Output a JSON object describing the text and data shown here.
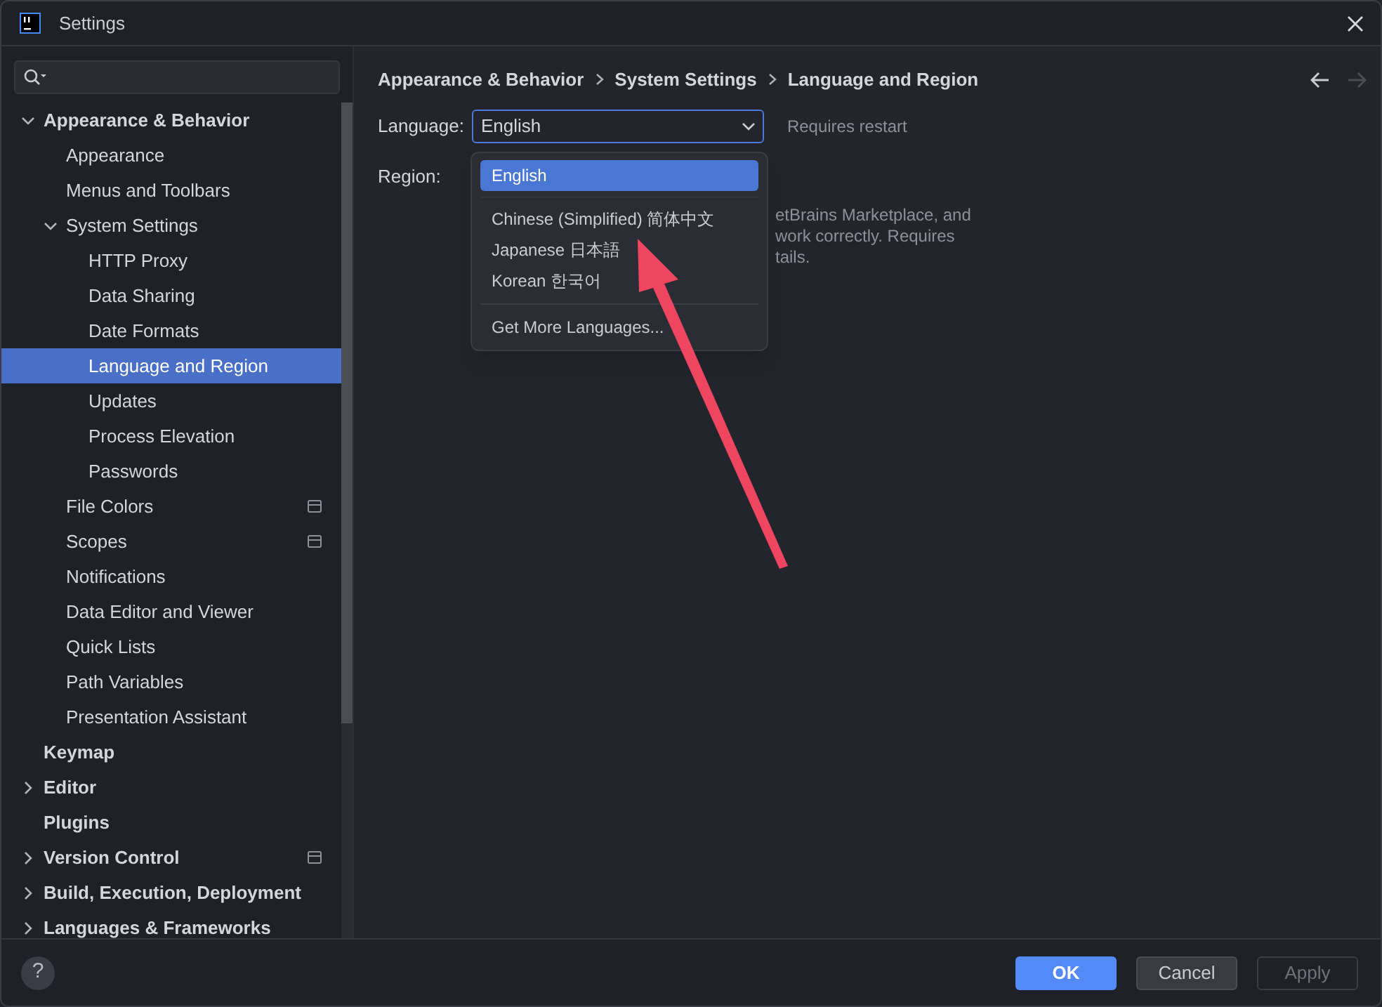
{
  "window": {
    "title": "Settings"
  },
  "sidebar": {
    "items": [
      {
        "label": "Appearance & Behavior",
        "expanded": true,
        "selected": false,
        "children": [
          {
            "label": "Appearance",
            "selected": false
          },
          {
            "label": "Menus and Toolbars",
            "selected": false
          },
          {
            "label": "System Settings",
            "expanded": true,
            "selected": false,
            "children": [
              {
                "label": "HTTP Proxy",
                "selected": false
              },
              {
                "label": "Data Sharing",
                "selected": false
              },
              {
                "label": "Date Formats",
                "selected": false
              },
              {
                "label": "Language and Region",
                "selected": true
              },
              {
                "label": "Updates",
                "selected": false
              },
              {
                "label": "Process Elevation",
                "selected": false
              },
              {
                "label": "Passwords",
                "selected": false
              }
            ]
          },
          {
            "label": "File Colors",
            "selected": false,
            "project_level": true
          },
          {
            "label": "Scopes",
            "selected": false,
            "project_level": true
          },
          {
            "label": "Notifications",
            "selected": false
          },
          {
            "label": "Data Editor and Viewer",
            "selected": false
          },
          {
            "label": "Quick Lists",
            "selected": false
          },
          {
            "label": "Path Variables",
            "selected": false
          },
          {
            "label": "Presentation Assistant",
            "selected": false
          }
        ]
      },
      {
        "label": "Keymap",
        "selected": false
      },
      {
        "label": "Editor",
        "expanded": false,
        "selected": false
      },
      {
        "label": "Plugins",
        "selected": false
      },
      {
        "label": "Version Control",
        "expanded": false,
        "selected": false,
        "project_level": true
      },
      {
        "label": "Build, Execution, Deployment",
        "expanded": false,
        "selected": false
      },
      {
        "label": "Languages & Frameworks",
        "expanded": false,
        "selected": false
      }
    ]
  },
  "breadcrumbs": [
    "Appearance & Behavior",
    "System Settings",
    "Language and Region"
  ],
  "navigation": {
    "back_enabled": true,
    "forward_enabled": false
  },
  "form": {
    "language": {
      "label": "Language:",
      "value": "English",
      "note": "Requires restart"
    },
    "region": {
      "label": "Region:",
      "hint_lines": [
        "etBrains Marketplace, and",
        "work correctly. Requires",
        "tails."
      ]
    }
  },
  "dropdown": {
    "options": [
      {
        "label": "English",
        "selected": true
      },
      {
        "label": "Chinese (Simplified) 简体中文",
        "selected": false
      },
      {
        "label": "Japanese 日本語",
        "selected": false
      },
      {
        "label": "Korean 한국어",
        "selected": false
      }
    ],
    "more": "Get More Languages..."
  },
  "buttons": [
    {
      "label": "OK",
      "kind": "primary",
      "disabled": false
    },
    {
      "label": "Cancel",
      "kind": "secondary",
      "disabled": false
    },
    {
      "label": "Apply",
      "kind": "secondary",
      "disabled": true
    }
  ],
  "help": {
    "label": "?"
  }
}
